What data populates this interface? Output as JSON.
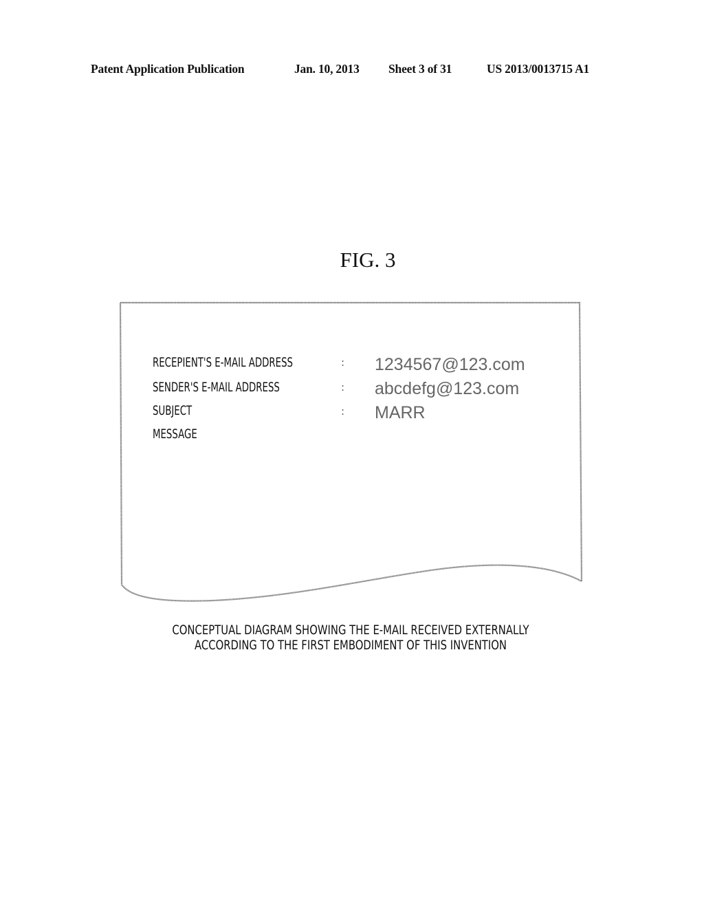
{
  "header": {
    "publication": "Patent Application Publication",
    "date": "Jan. 10, 2013",
    "sheet": "Sheet 3 of 31",
    "number": "US 2013/0013715 A1"
  },
  "figure": {
    "title": "FIG. 3",
    "email": {
      "fields": [
        {
          "label": "RECEPIENT'S E-MAIL ADDRESS",
          "separator": ":",
          "value": "1234567@123.com"
        },
        {
          "label": "SENDER'S E-MAIL ADDRESS",
          "separator": ":",
          "value": "abcdefg@123.com"
        },
        {
          "label": "SUBJECT",
          "separator": ":",
          "value": "MARR"
        },
        {
          "label": "MESSAGE",
          "separator": "",
          "value": ""
        }
      ]
    },
    "caption": {
      "line1": "CONCEPTUAL DIAGRAM SHOWING THE E-MAIL RECEIVED EXTERNALLY",
      "line2": "ACCORDING TO THE FIRST EMBODIMENT OF THIS INVENTION"
    }
  }
}
